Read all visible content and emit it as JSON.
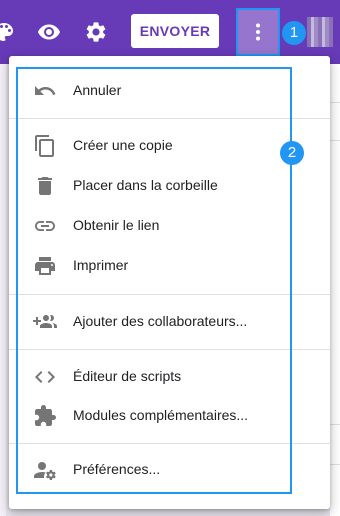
{
  "header": {
    "send_label": "ENVOYER",
    "icons": [
      "palette-icon",
      "preview-icon",
      "settings-icon",
      "more-vert-icon"
    ],
    "colors": {
      "header_bg": "#673ab7",
      "accent_button": "#9575cd"
    }
  },
  "annotations": {
    "badge_1": "1",
    "badge_2": "2",
    "highlight_color": "#2196f3"
  },
  "menu": {
    "items": [
      {
        "label": "Annuler",
        "icon": "undo-icon"
      },
      {
        "label": "Créer une copie",
        "icon": "copy-icon"
      },
      {
        "label": "Placer dans la corbeille",
        "icon": "trash-icon"
      },
      {
        "label": "Obtenir le lien",
        "icon": "link-icon"
      },
      {
        "label": "Imprimer",
        "icon": "print-icon"
      },
      {
        "label": "Ajouter des collaborateurs...",
        "icon": "add-people-icon"
      },
      {
        "label": "Éditeur de scripts",
        "icon": "code-icon"
      },
      {
        "label": "Modules complémentaires...",
        "icon": "puzzle-icon"
      },
      {
        "label": "Préférences...",
        "icon": "person-settings-icon"
      }
    ]
  }
}
